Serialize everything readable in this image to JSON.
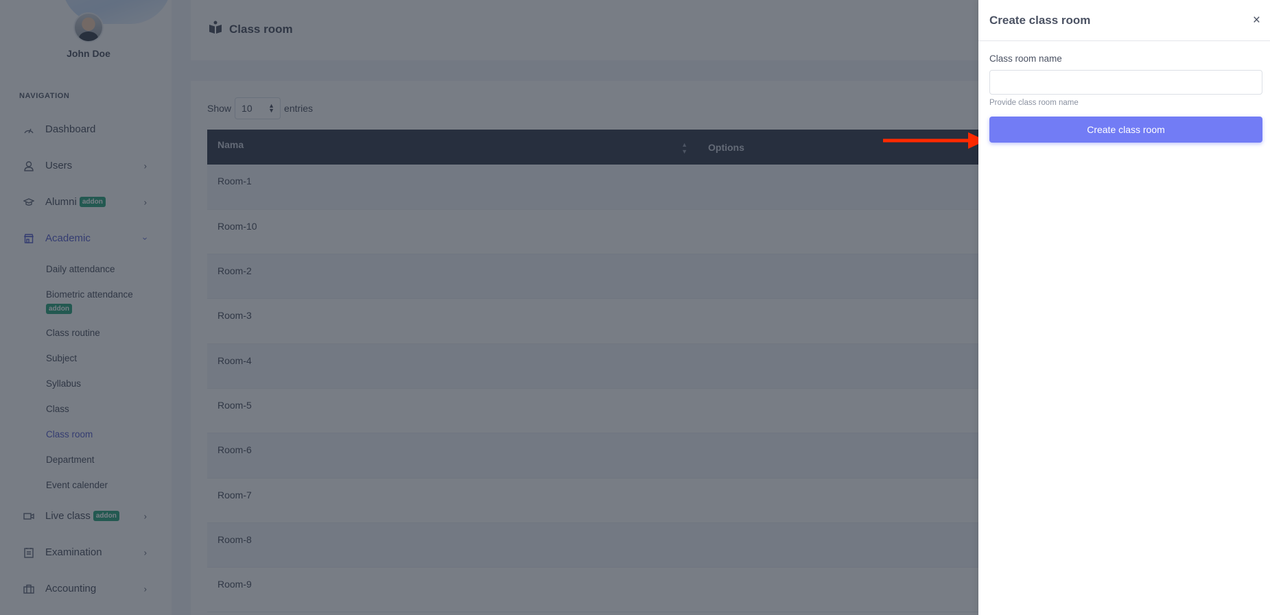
{
  "profile": {
    "name": "John Doe"
  },
  "navigation": {
    "heading": "NAVIGATION",
    "items": [
      {
        "label": "Dashboard",
        "icon": "dashboard-gauge-icon",
        "has_chevron": false
      },
      {
        "label": "Users",
        "icon": "user-icon",
        "has_chevron": true
      },
      {
        "label": "Alumni",
        "icon": "graduation-cap-icon",
        "badge": "addon",
        "has_chevron": true
      },
      {
        "label": "Academic",
        "icon": "school-icon",
        "has_chevron": true,
        "expanded": true,
        "active": true
      }
    ],
    "academic_subitems": [
      {
        "label": "Daily attendance"
      },
      {
        "label": "Biometric attendance",
        "badge": "addon"
      },
      {
        "label": "Class routine"
      },
      {
        "label": "Subject"
      },
      {
        "label": "Syllabus"
      },
      {
        "label": "Class"
      },
      {
        "label": "Class room",
        "active": true
      },
      {
        "label": "Department"
      },
      {
        "label": "Event calender"
      }
    ],
    "items_after": [
      {
        "label": "Live class",
        "icon": "video-camera-icon",
        "badge": "addon",
        "has_chevron": true
      },
      {
        "label": "Examination",
        "icon": "clipboard-icon",
        "has_chevron": true
      },
      {
        "label": "Accounting",
        "icon": "briefcase-icon",
        "has_chevron": true
      }
    ]
  },
  "page": {
    "title": "Class room",
    "title_icon": "book-reader-icon"
  },
  "table": {
    "length_prefix": "Show",
    "length_value": "10",
    "length_suffix": "entries",
    "columns": [
      "Nama",
      "Options"
    ],
    "rows": [
      {
        "name": "Room-1"
      },
      {
        "name": "Room-10"
      },
      {
        "name": "Room-2"
      },
      {
        "name": "Room-3"
      },
      {
        "name": "Room-4"
      },
      {
        "name": "Room-5"
      },
      {
        "name": "Room-6"
      },
      {
        "name": "Room-7"
      },
      {
        "name": "Room-8"
      },
      {
        "name": "Room-9"
      }
    ],
    "options_glyph": "⋮"
  },
  "drawer": {
    "title": "Create class room",
    "close_glyph": "×",
    "field_label": "Class room name",
    "field_value": "",
    "field_placeholder": "",
    "field_help": "Provide class room name",
    "submit_label": "Create class room"
  },
  "colors": {
    "accent": "#727cf5",
    "active_nav": "#4a53c8",
    "addon_badge": "#1e9e74",
    "table_header": "#283043",
    "annotation_arrow": "#ff2a00"
  }
}
